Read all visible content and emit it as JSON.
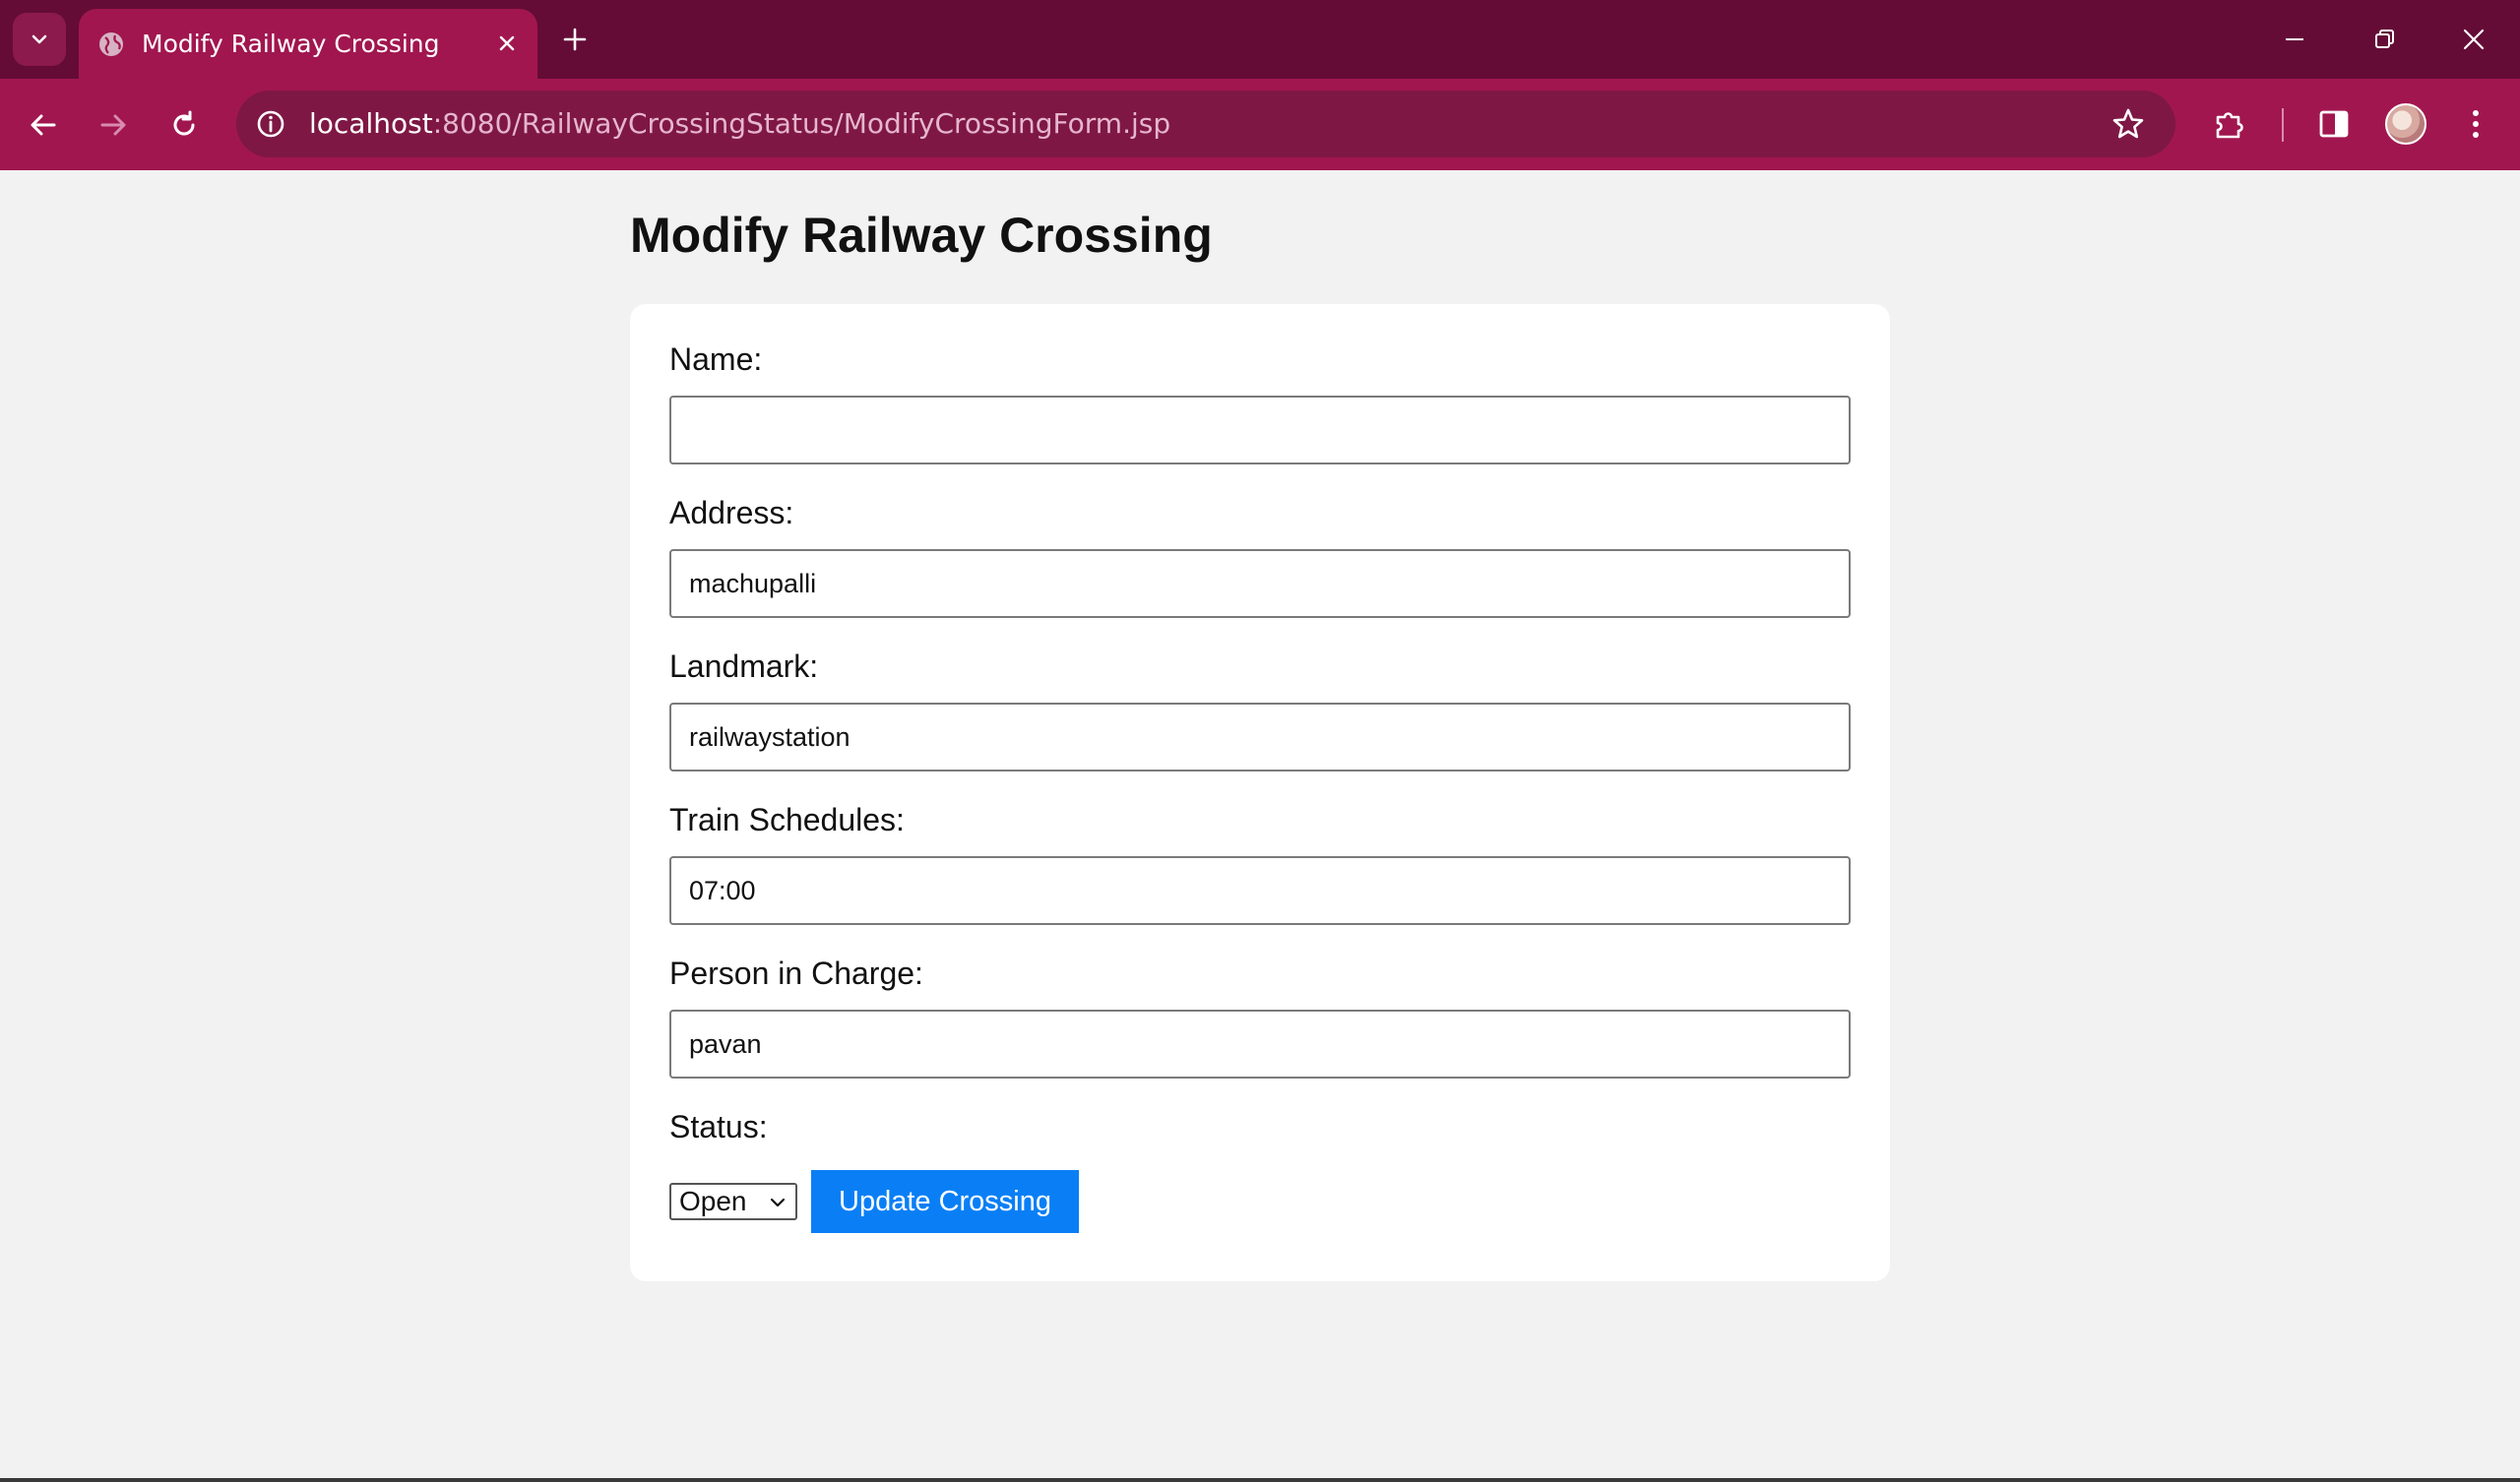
{
  "browser": {
    "tab_title": "Modify Railway Crossing",
    "url_host": "localhost",
    "url_path": ":8080/RailwayCrossingStatus/ModifyCrossingForm.jsp"
  },
  "page": {
    "title": "Modify Railway Crossing"
  },
  "form": {
    "name_label": "Name:",
    "name_value": "",
    "address_label": "Address:",
    "address_value": "machupalli",
    "landmark_label": "Landmark:",
    "landmark_value": "railwaystation",
    "schedules_label": "Train Schedules:",
    "schedules_value": "07:00",
    "person_label": "Person in Charge:",
    "person_value": "pavan",
    "status_label": "Status:",
    "status_selected": "Open",
    "submit_label": "Update Crossing"
  },
  "colors": {
    "tabbar": "#640c36",
    "toolbar": "#a1164f",
    "button": "#0a7ff5",
    "page_bg": "#f2f2f2"
  }
}
